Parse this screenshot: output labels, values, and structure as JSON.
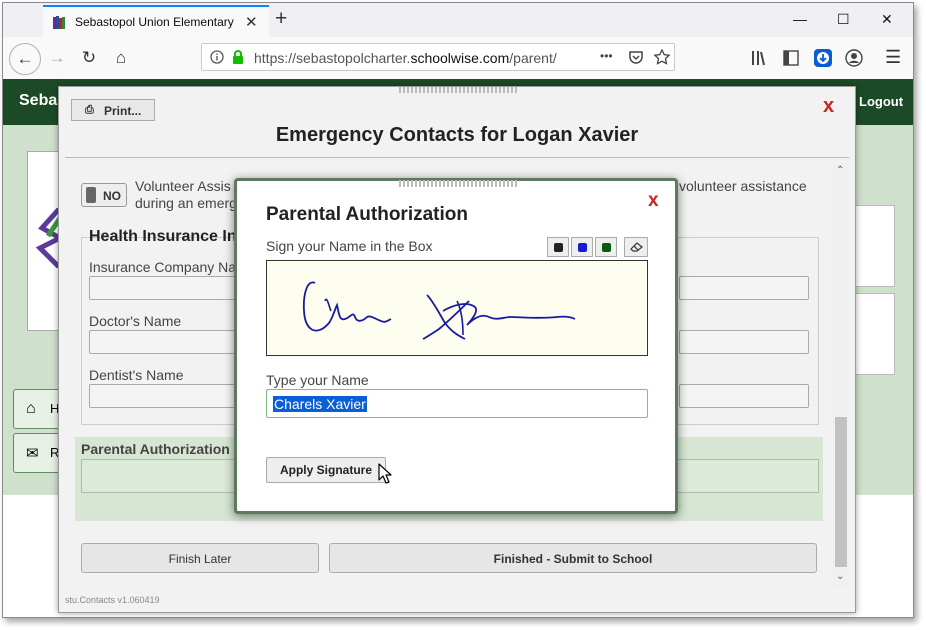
{
  "browser": {
    "tab_title": "Sebastopol Union Elementary D",
    "new_tab": "+",
    "close_tab": "✕",
    "win_min": "—",
    "win_max": "☐",
    "win_close": "✕",
    "url_prefix": "https://sebastopolcharter.",
    "url_domain": "schoolwise.com",
    "url_path": "/parent/",
    "url_more": "•••"
  },
  "page": {
    "brand": "Seba",
    "logout": "Logout",
    "side_btn_1": "H",
    "side_btn_2": "R"
  },
  "modal": {
    "print_label": "Print...",
    "title": "Emergency Contacts for Logan Xavier",
    "close": "x",
    "toggle": "NO",
    "volunteer_text_1": "Volunteer Assis",
    "volunteer_text_2": "during an emerg",
    "volunteer_text_right": "volunteer assistance",
    "health_heading": "Health Insurance In",
    "insurance_label": "Insurance Company Na",
    "doctor_label": "Doctor's Name",
    "dentist_label": "Dentist's Name",
    "parental_auth_label": "Parental Authorization",
    "finish_later": "Finish Later",
    "finished_submit": "Finished - Submit to School",
    "version": "stu.Contacts v1.060419"
  },
  "dialog": {
    "title": "Parental Authorization",
    "close": "x",
    "sign_label": "Sign your Name in the Box",
    "type_label": "Type your Name",
    "typed_name": "Charels Xavier",
    "apply_label": "Apply Signature"
  },
  "colors": {
    "pen_black": "#222222",
    "pen_blue": "#1a1ad6",
    "pen_green": "#0a5a0a",
    "header_green": "#1d4a26",
    "close_red": "#cc2222"
  }
}
